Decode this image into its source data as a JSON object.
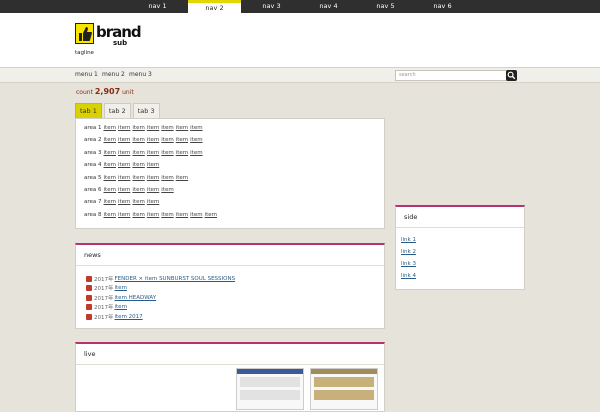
{
  "note": "Labels are placeholders — the source image was too small to read the real Japanese text.",
  "topnav": {
    "items": [
      "nav 1",
      "nav 2",
      "nav 3",
      "nav 4",
      "nav 5",
      "nav 6"
    ],
    "active_index": 1
  },
  "header": {
    "brand": "brand",
    "subbrand": "sub",
    "tagline": "tagline"
  },
  "subnav": {
    "items": [
      "menu 1",
      "menu 2",
      "menu 3"
    ]
  },
  "search": {
    "placeholder": "search"
  },
  "counter": {
    "label": "count",
    "value": "2,907",
    "unit": "unit"
  },
  "tabs": [
    {
      "label": "tab 1",
      "active": true
    },
    {
      "label": "tab 2",
      "active": false
    },
    {
      "label": "tab 3",
      "active": false
    }
  ],
  "areas": [
    {
      "region": "area 1",
      "prefs": [
        "item",
        "item",
        "item",
        "item",
        "item",
        "item",
        "item"
      ]
    },
    {
      "region": "area 2",
      "prefs": [
        "item",
        "item",
        "item",
        "item",
        "item",
        "item",
        "item"
      ]
    },
    {
      "region": "area 3",
      "prefs": [
        "item",
        "item",
        "item",
        "item",
        "item",
        "item",
        "item"
      ]
    },
    {
      "region": "area 4",
      "prefs": [
        "item",
        "item",
        "item",
        "item"
      ]
    },
    {
      "region": "area 5",
      "prefs": [
        "item",
        "item",
        "item",
        "item",
        "item",
        "item"
      ]
    },
    {
      "region": "area 6",
      "prefs": [
        "item",
        "item",
        "item",
        "item",
        "item"
      ]
    },
    {
      "region": "area 7",
      "prefs": [
        "item",
        "item",
        "item",
        "item"
      ]
    },
    {
      "region": "area 8",
      "prefs": [
        "item",
        "item",
        "item",
        "item",
        "item",
        "item",
        "item",
        "item"
      ]
    }
  ],
  "news": {
    "title": "news",
    "items": [
      {
        "date": "2017年",
        "text": "FENDER × item  SUNBURST SOUL SESSIONS"
      },
      {
        "date": "2017年",
        "text": "item"
      },
      {
        "date": "2017年",
        "text": "item  HEADWAY"
      },
      {
        "date": "2017年",
        "text": "item"
      },
      {
        "date": "2017年",
        "text": "item  2017"
      }
    ]
  },
  "live": {
    "title": "live"
  },
  "side": {
    "title": "side",
    "lines": [
      "link 1",
      "link 2",
      "link 3",
      "link 4"
    ]
  }
}
